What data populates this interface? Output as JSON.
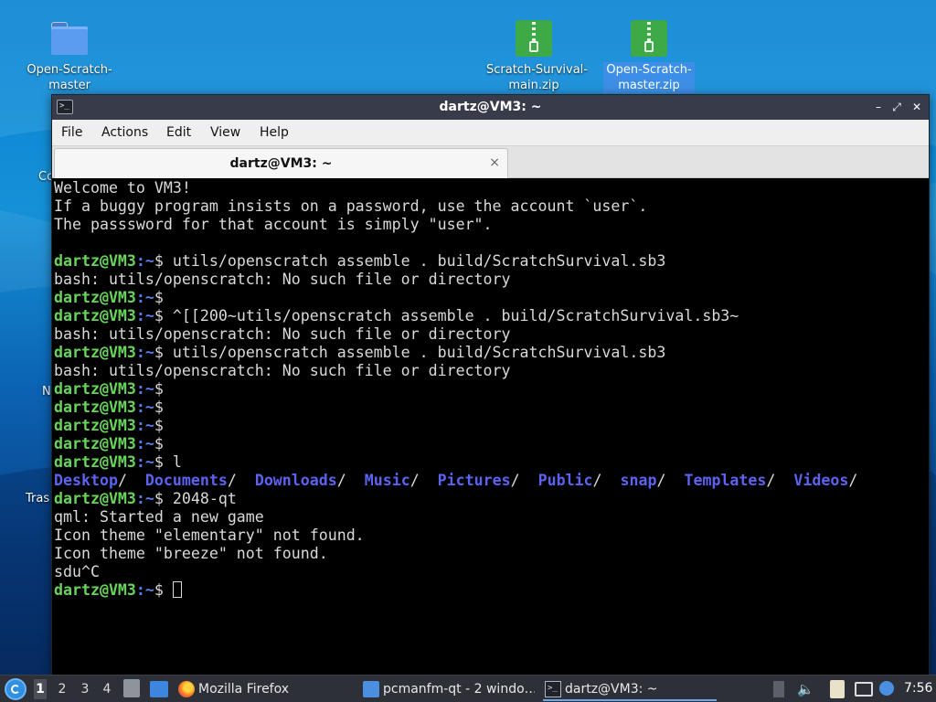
{
  "desktop": {
    "icons": [
      {
        "label": "Open-Scratch-\nmaster",
        "type": "folder"
      },
      {
        "label": "Scratch-Survival-\nmain.zip",
        "type": "zip"
      },
      {
        "label": "Open-Scratch-\nmaster.zip",
        "type": "zip",
        "selected": true
      }
    ],
    "partial_labels": [
      "Co",
      "N",
      "Tras"
    ]
  },
  "window": {
    "title": "dartz@VM3: ~",
    "menu": [
      "File",
      "Actions",
      "Edit",
      "View",
      "Help"
    ],
    "tab": {
      "label": "dartz@VM3: ~",
      "close": "×"
    },
    "buttons": {
      "minimize": "–",
      "restore": "⤢",
      "close": "✕"
    }
  },
  "terminal": {
    "prompt_user": "dartz@VM3",
    "prompt_path": ":~",
    "prompt_end": "$ ",
    "lines": [
      {
        "t": "text",
        "v": "Welcome to VM3!"
      },
      {
        "t": "text",
        "v": "If a buggy program insists on a password, use the account `user`."
      },
      {
        "t": "text",
        "v": "The passsword for that account is simply \"user\"."
      },
      {
        "t": "text",
        "v": ""
      },
      {
        "t": "prompt",
        "v": "utils/openscratch assemble . build/ScratchSurvival.sb3"
      },
      {
        "t": "text",
        "v": "bash: utils/openscratch: No such file or directory"
      },
      {
        "t": "prompt",
        "v": ""
      },
      {
        "t": "prompt",
        "v": "^[[200~utils/openscratch assemble . build/ScratchSurvival.sb3~"
      },
      {
        "t": "text",
        "v": "bash: utils/openscratch: No such file or directory"
      },
      {
        "t": "prompt",
        "v": "utils/openscratch assemble . build/ScratchSurvival.sb3"
      },
      {
        "t": "text",
        "v": "bash: utils/openscratch: No such file or directory"
      },
      {
        "t": "prompt",
        "v": ""
      },
      {
        "t": "prompt",
        "v": ""
      },
      {
        "t": "prompt",
        "v": ""
      },
      {
        "t": "prompt",
        "v": ""
      },
      {
        "t": "prompt",
        "v": "l"
      },
      {
        "t": "dirs",
        "v": [
          "Desktop/  ",
          "Documents/  ",
          "Downloads/  ",
          "Music/  ",
          "Pictures/  ",
          "Public/  ",
          "snap/  ",
          "Templates/  ",
          "Videos/"
        ]
      },
      {
        "t": "prompt",
        "v": "2048-qt"
      },
      {
        "t": "text",
        "v": "qml: Started a new game"
      },
      {
        "t": "text",
        "v": "Icon theme \"elementary\" not found."
      },
      {
        "t": "text",
        "v": "Icon theme \"breeze\" not found."
      },
      {
        "t": "text",
        "v": "sdu^C"
      },
      {
        "t": "prompt",
        "v": "",
        "cursor": true
      }
    ]
  },
  "taskbar": {
    "workspaces": [
      "1",
      "2",
      "3",
      "4"
    ],
    "active_workspace": "1",
    "tasks": [
      {
        "label": "Mozilla Firefox",
        "icon": "firefox-icon"
      },
      {
        "label": "pcmanfm-qt - 2 windo…",
        "icon": "folder-icon"
      },
      {
        "label": "dartz@VM3: ~",
        "icon": "terminal-icon",
        "active": true
      }
    ],
    "clock": "7:56"
  },
  "colors": {
    "prompt_user": "#67d55a",
    "prompt_path": "#5a7ef0",
    "directory": "#5b63f0",
    "terminal_bg": "#000000",
    "titlebar_bg": "#383c4a"
  }
}
